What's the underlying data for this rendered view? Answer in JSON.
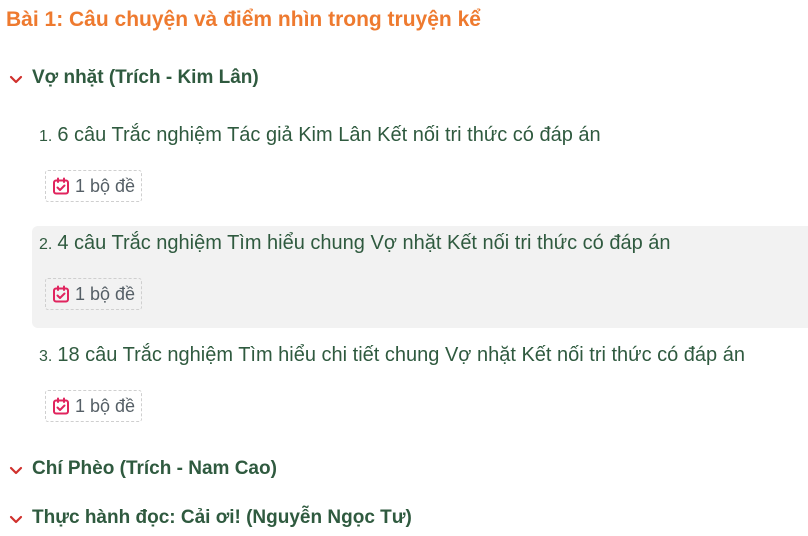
{
  "lesson": {
    "title": "Bài 1: Câu chuyện và điểm nhìn trong truyện kể"
  },
  "sections": [
    {
      "label": "Vợ nhặt (Trích - Kim Lân)",
      "items": [
        {
          "number": "1.",
          "title": "6 câu Trắc nghiệm Tác giả Kim Lân Kết nối tri thức có đáp án",
          "badge": "1 bộ đề"
        },
        {
          "number": "2.",
          "title": "4 câu Trắc nghiệm Tìm hiểu chung Vợ nhặt Kết nối tri thức có đáp án",
          "badge": "1 bộ đề"
        },
        {
          "number": "3.",
          "title": "18 câu Trắc nghiệm Tìm hiểu chi tiết chung Vợ nhặt Kết nối tri thức có đáp án",
          "badge": "1 bộ đề"
        }
      ]
    },
    {
      "label": "Chí Phèo (Trích - Nam Cao)"
    },
    {
      "label": "Thực hành đọc: Cải ơi! (Nguyễn Ngọc Tư)"
    }
  ],
  "icons": {
    "chevron": "chevron-down-icon",
    "badge": "calendar-check-icon"
  },
  "colors": {
    "title": "#ee7a2f",
    "text": "#2f5a3f",
    "chevron": "#d0312d",
    "badge_icon": "#e0245e",
    "highlight_bg": "#f2f2f2"
  }
}
